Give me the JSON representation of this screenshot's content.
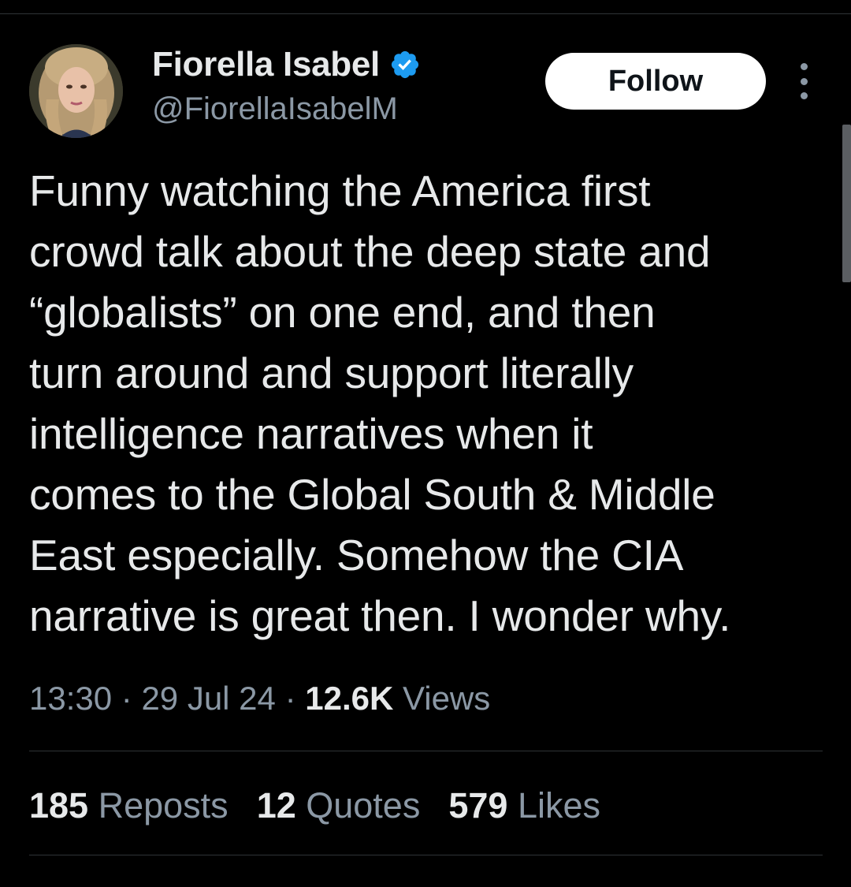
{
  "profile": {
    "display_name": "Fiorella Isabel",
    "handle": "@FiorellaIsabelM",
    "verified_icon": "verified-badge-icon",
    "avatar_icon": "profile-photo"
  },
  "actions": {
    "follow_label": "Follow",
    "more_icon": "more-options-icon"
  },
  "tweet": {
    "text": "Funny watching the America first\ncrowd talk about the deep state and\n“globalists” on one end, and then\nturn around and support literally\nintelligence narratives when it\ncomes to the Global South & Middle\nEast especially. Somehow the CIA\nnarrative is great then. I wonder why."
  },
  "meta": {
    "time": "13:30",
    "separator": " · ",
    "date": "29 Jul 24",
    "views_count": "12.6K",
    "views_label": " Views"
  },
  "stats": [
    {
      "count": "185",
      "label": " Reposts"
    },
    {
      "count": "12",
      "label": " Quotes"
    },
    {
      "count": "579",
      "label": " Likes"
    }
  ],
  "colors": {
    "background": "#000000",
    "text": "#e7e9ea",
    "secondary_text": "#8b98a5",
    "verified": "#1d9bf0",
    "divider": "#2f3336"
  }
}
